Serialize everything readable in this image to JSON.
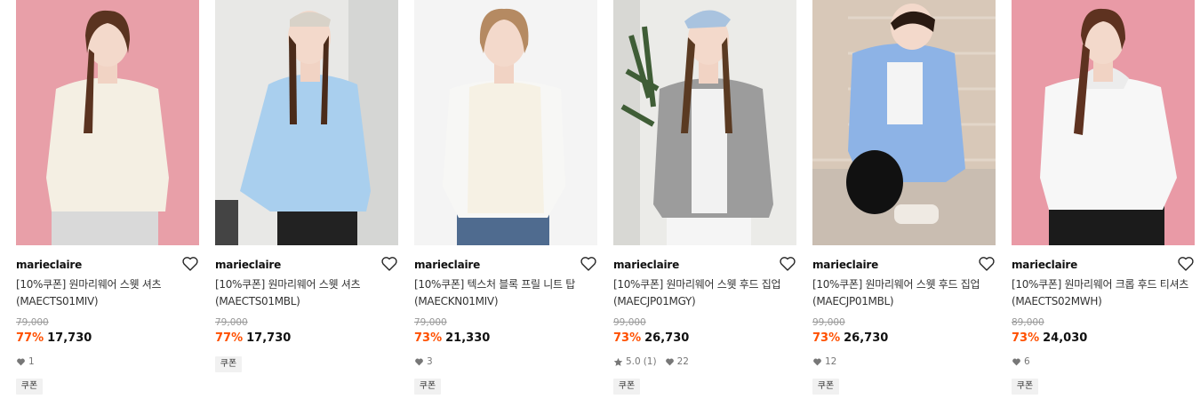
{
  "products": [
    {
      "brand": "marieclaire",
      "title": "[10%쿠폰] 원마리웨어 스웻 셔츠 (MAECTS01MIV)",
      "original_price": "79,000",
      "discount": "77%",
      "price": "17,730",
      "likes": "1",
      "rating": "",
      "reviews": "",
      "coupon": "쿠폰",
      "bg_color": "#e89fa8",
      "garment_color": "#f4efe3"
    },
    {
      "brand": "marieclaire",
      "title": "[10%쿠폰] 원마리웨어 스웻 셔츠 (MAECTS01MBL)",
      "original_price": "79,000",
      "discount": "77%",
      "price": "17,730",
      "likes": "",
      "rating": "",
      "reviews": "",
      "coupon": "쿠폰",
      "bg_color": "#e8e8e6",
      "garment_color": "#a9cfee"
    },
    {
      "brand": "marieclaire",
      "title": "[10%쿠폰] 텍스처 블록 프릴 니트 탑 (MAECKN01MIV)",
      "original_price": "79,000",
      "discount": "73%",
      "price": "21,330",
      "likes": "3",
      "rating": "",
      "reviews": "",
      "coupon": "쿠폰",
      "bg_color": "#f4f4f4",
      "garment_color": "#f6f1e4"
    },
    {
      "brand": "marieclaire",
      "title": "[10%쿠폰] 원마리웨어 스웻 후드 집업 (MAECJP01MGY)",
      "original_price": "99,000",
      "discount": "73%",
      "price": "26,730",
      "likes": "22",
      "rating": "5.0",
      "reviews": "(1)",
      "coupon": "쿠폰",
      "bg_color": "#ebebe8",
      "garment_color": "#9c9c9c"
    },
    {
      "brand": "marieclaire",
      "title": "[10%쿠폰] 원마리웨어 스웻 후드 집업 (MAECJP01MBL)",
      "original_price": "99,000",
      "discount": "73%",
      "price": "26,730",
      "likes": "12",
      "rating": "",
      "reviews": "",
      "coupon": "쿠폰",
      "bg_color": "#d8c8b8",
      "garment_color": "#8db3e6"
    },
    {
      "brand": "marieclaire",
      "title": "[10%쿠폰] 원마리웨어 크롭 후드 티셔츠(MAECTS02MWH)",
      "original_price": "89,000",
      "discount": "73%",
      "price": "24,030",
      "likes": "6",
      "rating": "",
      "reviews": "",
      "coupon": "쿠폰",
      "bg_color": "#e99aa6",
      "garment_color": "#f7f7f7"
    }
  ]
}
